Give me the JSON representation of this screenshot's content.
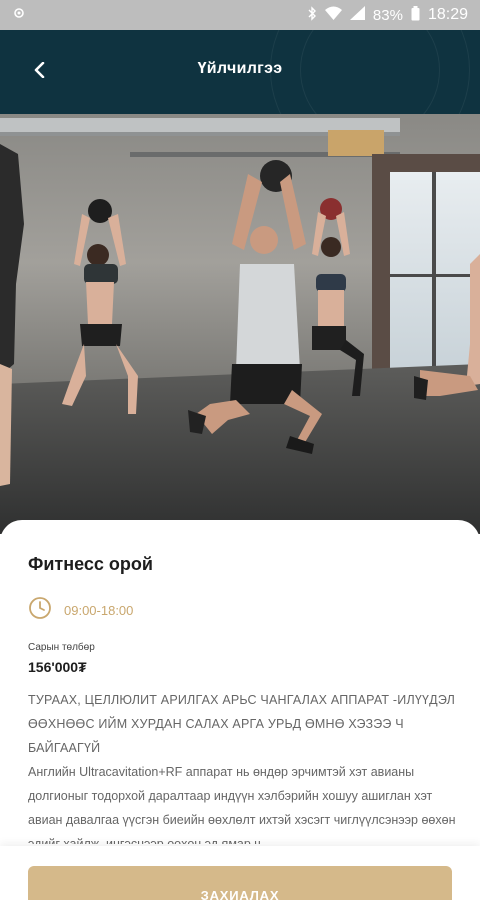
{
  "status_bar": {
    "battery_percent": "83%",
    "time": "18:29",
    "icons": [
      "app-notification-icon",
      "bluetooth-icon",
      "wifi-icon",
      "signal-icon",
      "battery-icon"
    ]
  },
  "header": {
    "title": "Үйлчилгээ",
    "back_icon": "chevron-left-icon"
  },
  "hero": {
    "image": "fitness-class-photo"
  },
  "service": {
    "title": "Фитнесс орой",
    "hours": "09:00-18:00",
    "hours_icon": "clock-icon",
    "price_label": "Сарын төлбөр",
    "price": "156'000₮",
    "description_heading": "ТУРААХ, ЦЕЛЛЮЛИТ АРИЛГАХ АРЬС ЧАНГАЛАХ АППАРАТ -ИЛҮҮДЭЛ ӨӨХНӨӨС ИЙМ ХУРДАН САЛАХ АРГА УРЬД ӨМНӨ ХЭЗЭЭ Ч БАЙГААГҮЙ",
    "description_body": "Английн Ultracavitation+RF аппарат нь өндөр эрчимтэй хэт авианы долгионыг тодорхой даралтаар индүүн хэлбэрийн хошуу ашиглан хэт авиан давалгаа үүсгэн биеийн өөхлөлт ихтэй хэсэгт чиглүүлсэнээр өөхөн эдийг хайлж, ингэснээр өөхөн эд ямар ч"
  },
  "actions": {
    "order_label": "ЗАХИАЛАХ"
  },
  "colors": {
    "header_bg": "#0f3340",
    "accent_gold": "#c9a76e",
    "button_bg": "#d5b98a",
    "status_bar_bg": "#bdbdbd"
  }
}
